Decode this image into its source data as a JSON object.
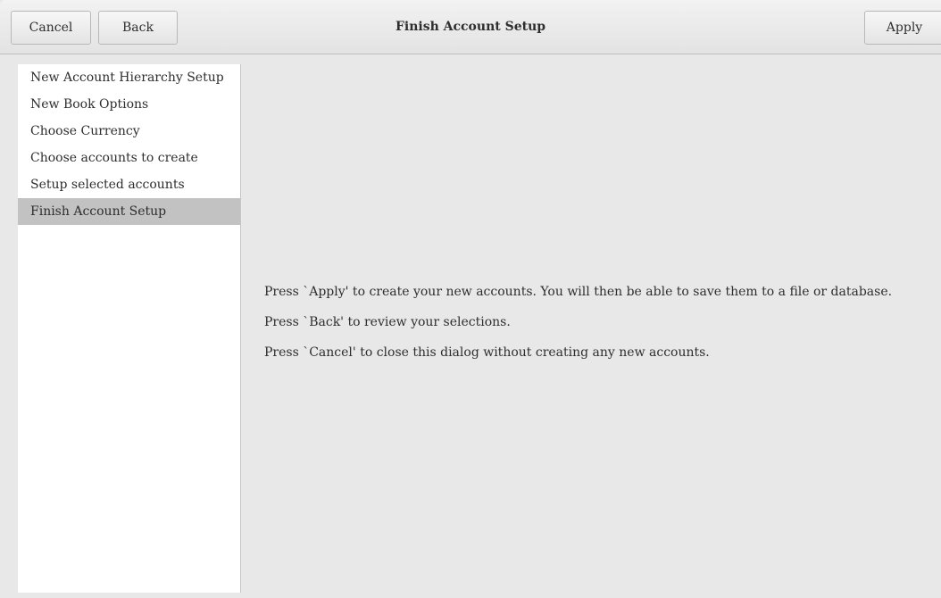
{
  "header": {
    "cancel_label": "Cancel",
    "back_label": "Back",
    "title": "Finish Account Setup",
    "apply_label": "Apply"
  },
  "sidebar": {
    "items": [
      {
        "label": "New Account Hierarchy Setup",
        "active": false
      },
      {
        "label": "New Book Options",
        "active": false
      },
      {
        "label": "Choose Currency",
        "active": false
      },
      {
        "label": "Choose accounts to create",
        "active": false
      },
      {
        "label": "Setup selected accounts",
        "active": false
      },
      {
        "label": "Finish Account Setup",
        "active": true
      }
    ]
  },
  "main": {
    "lines": [
      "Press `Apply' to create your new accounts. You will then be able to save them to a file or database.",
      "Press `Back' to review your selections.",
      "Press `Cancel' to close this dialog without creating any new accounts."
    ]
  },
  "colors": {
    "selected_row": "#c2c2c2",
    "window_bg": "#e8e8e8",
    "sidebar_bg": "#ffffff"
  }
}
